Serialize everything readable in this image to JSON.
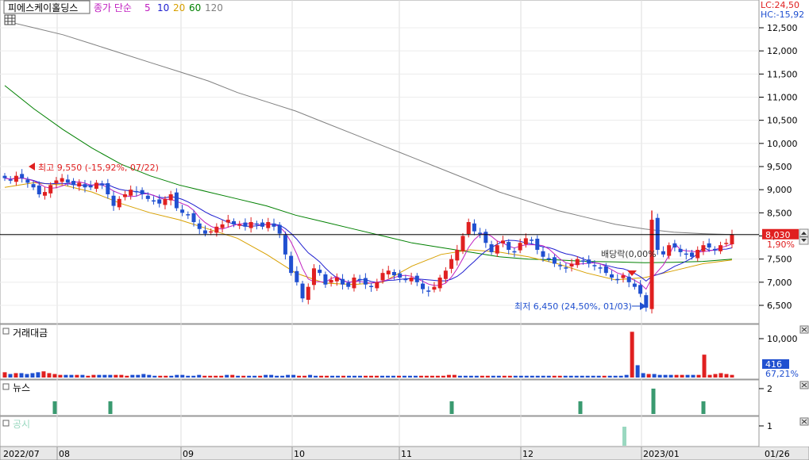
{
  "header": {
    "company": "피에스케이홀딩스",
    "ma_label": "종가 단순",
    "ma_periods": [
      {
        "label": "5",
        "color": "#c020c0"
      },
      {
        "label": "10",
        "color": "#2020d0"
      },
      {
        "label": "20",
        "color": "#d8a000"
      },
      {
        "label": "60",
        "color": "#008000"
      },
      {
        "label": "120",
        "color": "#808080"
      }
    ]
  },
  "badges": {
    "lc": "LC:24,50",
    "hc": "HC:-15,92"
  },
  "price_axis": {
    "ticks": [
      "12,500",
      "12,000",
      "11,500",
      "11,000",
      "10,500",
      "10,000",
      "9,500",
      "9,000",
      "8,500",
      "8,000",
      "7,500",
      "7,000",
      "6,500"
    ],
    "current_value": 8030,
    "current_label": "8,030",
    "current_change": "1,90%"
  },
  "annotations": {
    "high": "최고 9,550 (-15,92%, 07/22)",
    "low": "최저 6,450 (24,50%, 01/03)",
    "dividend": "배당락(0,00%"
  },
  "panels": {
    "volume_title": "거래대금",
    "volume_ticks": [
      "10,000"
    ],
    "volume_value": "416",
    "volume_pct": "67,21%",
    "news_title": "뉴스",
    "news_ticks": [
      "2"
    ],
    "disclosure_title": "공시",
    "disclosure_ticks": [
      "1"
    ]
  },
  "x_axis": {
    "labels": [
      "2022/07",
      "08",
      "09",
      "10",
      "11",
      "12",
      "2023/01",
      "01/26"
    ]
  },
  "colors": {
    "up": "#e02020",
    "down": "#2050d0",
    "ma5": "#c020c0",
    "ma10": "#2020d0",
    "ma20": "#d8a000",
    "ma60": "#008000",
    "ma120": "#808080",
    "news": "#3a9a70",
    "disclosure": "#9ad8c0"
  },
  "chart_data": {
    "type": "candlestick",
    "y_range": [
      6300,
      12800
    ],
    "price_series_close": [
      9250,
      9200,
      9300,
      9250,
      9150,
      9050,
      8900,
      8950,
      9100,
      9200,
      9250,
      9150,
      9100,
      9150,
      9050,
      9050,
      9150,
      9100,
      8900,
      8650,
      8800,
      8900,
      9000,
      8950,
      8900,
      8800,
      8750,
      8700,
      8800,
      8900,
      8600,
      8500,
      8450,
      8300,
      8150,
      8050,
      8100,
      8200,
      8250,
      8350,
      8250,
      8250,
      8200,
      8300,
      8250,
      8200,
      8300,
      8200,
      8050,
      7600,
      7200,
      7000,
      6650,
      6900,
      7300,
      7200,
      6950,
      7050,
      7100,
      6950,
      6900,
      7100,
      7050,
      6950,
      6900,
      7000,
      7200,
      7250,
      7150,
      7100,
      7050,
      7100,
      7000,
      6850,
      6800,
      6900,
      7100,
      7250,
      7500,
      7700,
      8000,
      8300,
      8100,
      8050,
      7850,
      7650,
      7800,
      7900,
      7700,
      7650,
      7850,
      7950,
      7900,
      7700,
      7550,
      7500,
      7400,
      7350,
      7300,
      7400,
      7500,
      7450,
      7400,
      7350,
      7300,
      7200,
      7100,
      7050,
      7150,
      7000,
      6900,
      6750,
      6450,
      8350,
      7700,
      7600,
      7800,
      7750,
      7650,
      7600,
      7550,
      7700,
      7800,
      7750,
      7700,
      7800,
      7850,
      8030
    ],
    "volume_series": [
      6,
      4,
      5,
      5,
      4,
      5,
      6,
      7,
      5,
      4,
      3,
      3,
      3,
      3,
      3,
      2,
      3,
      3,
      3,
      3,
      3,
      3,
      2,
      3,
      3,
      4,
      3,
      2,
      2,
      2,
      2,
      3,
      3,
      2,
      2,
      3,
      2,
      2,
      2,
      2,
      3,
      3,
      2,
      2,
      2,
      2,
      2,
      3,
      3,
      2,
      2,
      3,
      3,
      2,
      2,
      3,
      2,
      2,
      2,
      2,
      2,
      2,
      2,
      2,
      2,
      2,
      2,
      2,
      2,
      2,
      2,
      2,
      2,
      2,
      2,
      2,
      2,
      2,
      2,
      2,
      3,
      3,
      2,
      2,
      2,
      2,
      2,
      2,
      2,
      2,
      2,
      2,
      2,
      2,
      2,
      2,
      2,
      2,
      2,
      2,
      2,
      2,
      2,
      2,
      2,
      2,
      2,
      2,
      2,
      2,
      2,
      2,
      3,
      52,
      14,
      5,
      4,
      4,
      3,
      3,
      3,
      3,
      3,
      3,
      3,
      3,
      26,
      3,
      4,
      5,
      4,
      3
    ],
    "volume_range": [
      0,
      11000
    ],
    "news_counts_at": [
      [
        17,
        1
      ],
      [
        35,
        1
      ],
      [
        146,
        1
      ],
      [
        188,
        1
      ],
      [
        212,
        2
      ],
      [
        228,
        1
      ]
    ],
    "disclosure_counts_at": [
      [
        202,
        1
      ]
    ],
    "ma120_series": [
      12650,
      12500,
      12350,
      12150,
      11950,
      11750,
      11550,
      11350,
      11100,
      10900,
      10700,
      10450,
      10200,
      9950,
      9700,
      9450,
      9200,
      8950,
      8750,
      8550,
      8400,
      8250,
      8150,
      8080,
      8050,
      8030
    ],
    "ma60_series": [
      11250,
      10750,
      10300,
      9900,
      9550,
      9300,
      9100,
      8950,
      8800,
      8650,
      8450,
      8300,
      8150,
      8000,
      7850,
      7750,
      7650,
      7550,
      7500,
      7480,
      7450,
      7440,
      7420,
      7430,
      7450,
      7500
    ],
    "ma20_series": [
      9050,
      9150,
      9100,
      8950,
      8700,
      8500,
      8350,
      8150,
      7950,
      7600,
      7200,
      6980,
      6950,
      7000,
      7350,
      7600,
      7700,
      7650,
      7550,
      7400,
      7200,
      7050,
      7100,
      7250,
      7400,
      7480
    ]
  }
}
